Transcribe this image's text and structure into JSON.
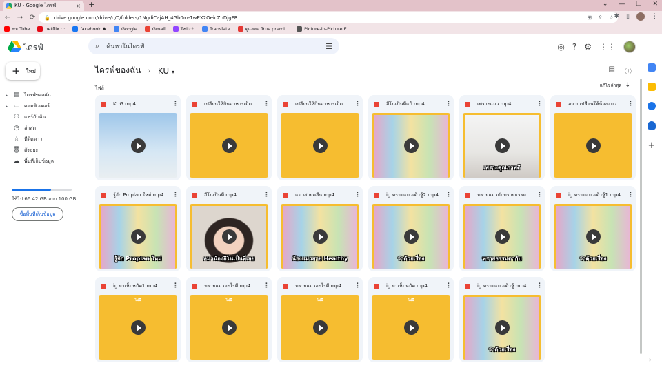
{
  "browser": {
    "tab_title": "KU - Google ไดรฟ์",
    "tab_close": "×",
    "new_tab": "+",
    "url": "drive.google.com/drive/u/0/folders/1NgdiCajAH_4Gb0m-1wEX2OeicZhDjgFR",
    "window_controls": [
      "⌄",
      "—",
      "❐",
      "✕"
    ],
    "nav": [
      "←",
      "→",
      "⟳"
    ],
    "bookmarks": [
      {
        "label": "YouTube",
        "color": "#ff0000"
      },
      {
        "label": "netflix : :",
        "color": "#e50914"
      },
      {
        "label": "facebook ♠",
        "color": "#1877f2"
      },
      {
        "label": "Google",
        "color": "#4285f4"
      },
      {
        "label": "Gmail",
        "color": "#ea4335"
      },
      {
        "label": "Twitch",
        "color": "#9146ff"
      },
      {
        "label": "Translate",
        "color": "#4285f4"
      },
      {
        "label": "ดูแลลด True premi...",
        "color": "#e53935"
      },
      {
        "label": "Picture-in-Picture E...",
        "color": "#555555"
      }
    ]
  },
  "drive": {
    "logo_text": "ไดรฟ์",
    "search_placeholder": "ค้นหาในไดรฟ์",
    "new_button": "ใหม่",
    "nav": [
      {
        "label": "ไดรฟ์ของฉัน",
        "icon": "my-drive-icon",
        "glyph": "▤",
        "caret": "▸"
      },
      {
        "label": "คอมพิวเตอร์",
        "icon": "computer-icon",
        "glyph": "▭",
        "caret": "▸"
      },
      {
        "label": "แชร์กับฉัน",
        "icon": "shared-icon",
        "glyph": "⚇",
        "caret": ""
      },
      {
        "label": "ล่าสุด",
        "icon": "recent-icon",
        "glyph": "◷",
        "caret": ""
      },
      {
        "label": "ที่ติดดาว",
        "icon": "star-icon",
        "glyph": "☆",
        "caret": ""
      },
      {
        "label": "ถังขยะ",
        "icon": "trash-icon",
        "glyph": "🗑",
        "caret": ""
      },
      {
        "label": "พื้นที่เก็บข้อมูล",
        "icon": "cloud-icon",
        "glyph": "☁",
        "caret": ""
      }
    ],
    "storage_text": "ใช้ไป 66.42 GB จาก 100 GB",
    "storage_used_fraction": 0.66,
    "buy_storage": "ซื้อพื้นที่เก็บข้อมูล",
    "breadcrumb": {
      "root": "ไดรฟ์ของฉัน",
      "sep": "›",
      "current": "KU",
      "dropdown": "▾"
    },
    "files_label": "ไฟล์",
    "sort_label": "แก้ไขล่าสุด",
    "sort_arrow": "↓",
    "files": [
      {
        "name": "KUG.mp4",
        "thumb": "sky",
        "caption": "",
        "badge": ""
      },
      {
        "name": "เปลี่ยนให้กินอาหารเม็ด...",
        "thumb": "yellow",
        "caption": "",
        "badge": ""
      },
      {
        "name": "เปลี่ยนให้กินอาหารเม็ด...",
        "thumb": "yellow",
        "caption": "",
        "badge": ""
      },
      {
        "name": "อีโนเป็นที่แก้.mp4",
        "thumb": "photo shelves",
        "caption": "",
        "badge": ""
      },
      {
        "name": "เพราะแมว.mp4",
        "thumb": "photo whiteroom",
        "caption": "เพราะคุณภาพดี",
        "badge": ""
      },
      {
        "name": "อยากเปลี่ยนให้น้องแมว...",
        "thumb": "yellow",
        "caption": "",
        "badge": ""
      },
      {
        "name": "รู้จัก Proplan ใหม่.mp4",
        "thumb": "photo shelves",
        "caption": "รู้จัก Proplan ใหม่",
        "badge": ""
      },
      {
        "name": "อีโนเป็นที่.mp4",
        "thumb": "photo face",
        "caption": "หมาน้องอีโนเป็นที่เลย",
        "badge": ""
      },
      {
        "name": "แมวสายคลีน.mp4",
        "thumb": "photo shelves",
        "caption": "น้องแมวสาย Healthy",
        "badge": ""
      },
      {
        "name": "ig ทรายแมวเต้าหู้2.mp4",
        "thumb": "photo shelves",
        "caption": "ว่าด้วยเรื่อง",
        "badge": ""
      },
      {
        "name": "ทรายแมวกับทรายธรรม...",
        "thumb": "photo shelves",
        "caption": "ทรายธรรมดากับ",
        "badge": ""
      },
      {
        "name": "ig ทรายแมวเต้าหู้1.mp4",
        "thumb": "photo shelves",
        "caption": "ว่าด้วยเรื่อง",
        "badge": ""
      },
      {
        "name": "ig ยาเห็บหมัด1.mp4",
        "thumb": "yellow",
        "caption": "",
        "badge": "ไม่มี"
      },
      {
        "name": "ทรายแมวอะไรดี.mp4",
        "thumb": "yellow",
        "caption": "",
        "badge": "ไม่มี"
      },
      {
        "name": "ทรายแมวอะไรดี.mp4",
        "thumb": "yellow",
        "caption": "",
        "badge": "ไม่มี"
      },
      {
        "name": "ig ยาเห็บหมัด.mp4",
        "thumb": "yellow",
        "caption": "",
        "badge": "ไม่มี"
      },
      {
        "name": "ig ทรายแมวเต้าหู้.mp4",
        "thumb": "photo shelves",
        "caption": "ว่าด้วยเรื่อง",
        "badge": ""
      }
    ]
  }
}
